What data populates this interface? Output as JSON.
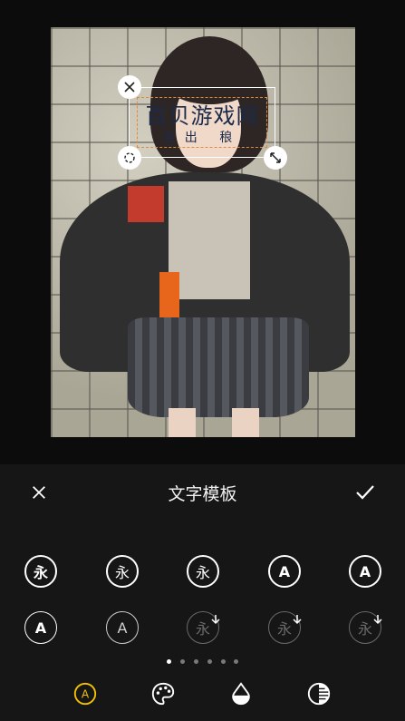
{
  "watermark": {
    "main": "百贝游戏网",
    "sub": "合出  稂"
  },
  "panel": {
    "title": "文字模板"
  },
  "style_glyphs": {
    "yong": "永",
    "a": "A"
  },
  "pager": {
    "count": 6,
    "active_index": 0
  },
  "tabs": [
    {
      "icon": "font-style-icon",
      "active": true
    },
    {
      "icon": "palette-icon",
      "active": false
    },
    {
      "icon": "opacity-drop-icon",
      "active": false
    },
    {
      "icon": "gradient-circle-icon",
      "active": false
    }
  ],
  "colors": {
    "accent": "#f2c200",
    "panel_bg": "#161616"
  }
}
